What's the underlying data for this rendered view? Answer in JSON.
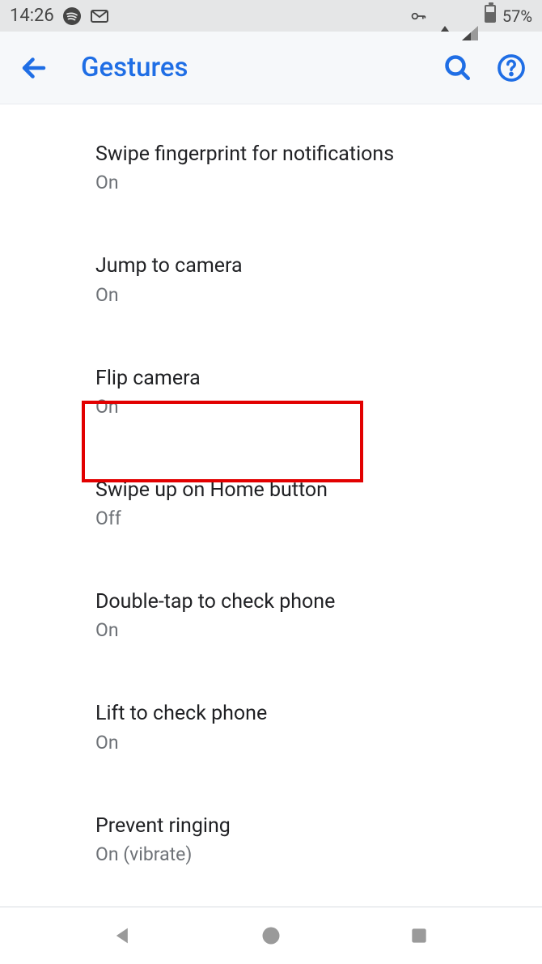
{
  "status_bar": {
    "time": "14:26",
    "battery_text": "57%"
  },
  "app_bar": {
    "title": "Gestures"
  },
  "items": [
    {
      "title": "Swipe fingerprint for notifications",
      "status": "On"
    },
    {
      "title": "Jump to camera",
      "status": "On"
    },
    {
      "title": "Flip camera",
      "status": "On"
    },
    {
      "title": "Swipe up on Home button",
      "status": "Off"
    },
    {
      "title": "Double-tap to check phone",
      "status": "On"
    },
    {
      "title": "Lift to check phone",
      "status": "On"
    },
    {
      "title": "Prevent ringing",
      "status": "On (vibrate)"
    }
  ],
  "highlighted_index": 3
}
